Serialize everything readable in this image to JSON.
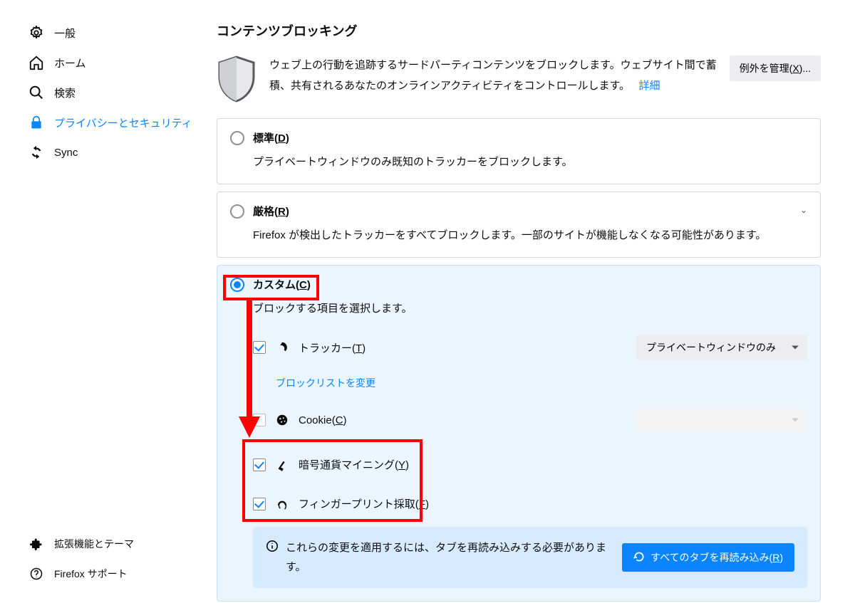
{
  "sidebar": {
    "items": [
      {
        "label": "一般"
      },
      {
        "label": "ホーム"
      },
      {
        "label": "検索"
      },
      {
        "label": "プライバシーとセキュリティ"
      },
      {
        "label": "Sync"
      }
    ],
    "bottom": [
      {
        "label": "拡張機能とテーマ"
      },
      {
        "label": "Firefox サポート"
      }
    ]
  },
  "section": {
    "title": "コンテンツブロッキング",
    "intro": "ウェブ上の行動を追跡するサードパーティコンテンツをブロックします。ウェブサイト間で蓄積、共有されるあなたのオンラインアクティビティをコントロールします。",
    "detail_link": "詳細",
    "manage_exceptions_pre": "例外を管理(",
    "manage_exceptions_key": "X",
    "manage_exceptions_post": ")..."
  },
  "standard": {
    "title_pre": "標準(",
    "title_key": "D",
    "title_post": ")",
    "desc": "プライベートウィンドウのみ既知のトラッカーをブロックします。"
  },
  "strict": {
    "title_pre": "厳格(",
    "title_key": "R",
    "title_post": ")",
    "desc": "Firefox が検出したトラッカーをすべてブロックします。一部のサイトが機能しなくなる可能性があります。"
  },
  "custom": {
    "title_pre": "カスタム(",
    "title_key": "C",
    "title_post": ")",
    "desc": "ブロックする項目を選択します。",
    "trackers_pre": "トラッカー(",
    "trackers_key": "T",
    "trackers_post": ")",
    "trackers_dropdown": "プライベートウィンドウのみ",
    "change_blocklist": "ブロックリストを変更",
    "cookies_pre": "Cookie(",
    "cookies_key": "C",
    "cookies_post": ")",
    "crypto_pre": "暗号通貨マイニング(",
    "crypto_key": "Y",
    "crypto_post": ")",
    "fingerprint_pre": "フィンガープリント採取(",
    "fingerprint_key": "F",
    "fingerprint_post": ")"
  },
  "reload": {
    "text": "これらの変更を適用するには、タブを再読み込みする必要があります。",
    "button_pre": "すべてのタブを再読み込み(",
    "button_key": "R",
    "button_post": ")"
  }
}
